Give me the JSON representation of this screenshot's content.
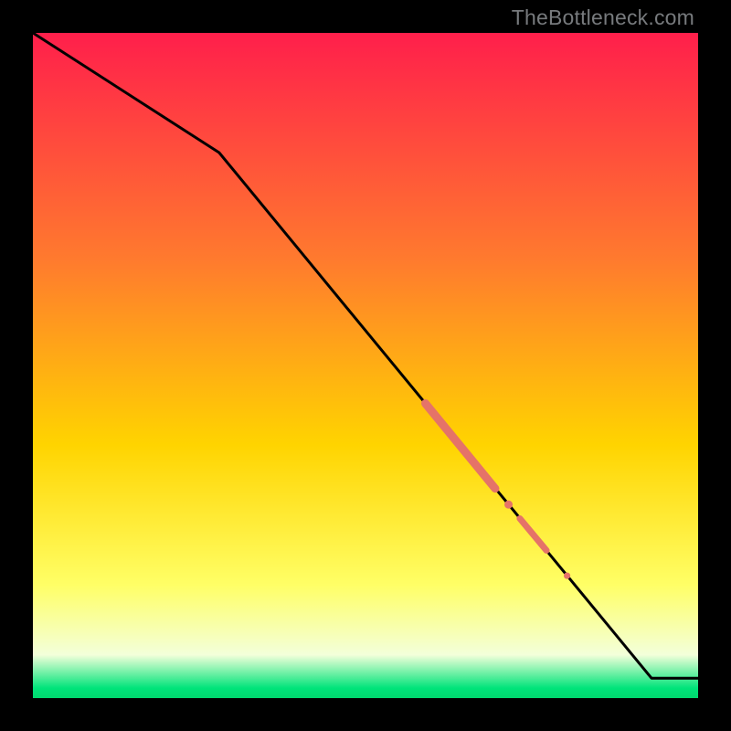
{
  "watermark": "TheBottleneck.com",
  "colors": {
    "frame": "#000000",
    "line": "#000000",
    "marker": "#e57368",
    "grad_top": "#ff1f4b",
    "grad_mid1": "#ff7a2e",
    "grad_mid2": "#ffd400",
    "grad_mid3": "#ffff66",
    "grad_pale": "#f3ffda",
    "grad_green": "#00e47a"
  },
  "chart_data": {
    "type": "line",
    "title": "",
    "xlabel": "",
    "ylabel": "",
    "xlim": [
      0,
      100
    ],
    "ylim": [
      0,
      100
    ],
    "series": [
      {
        "name": "curve",
        "x": [
          0,
          28,
          93,
          100
        ],
        "y": [
          100,
          82,
          3,
          3
        ]
      }
    ],
    "markers": [
      {
        "name": "segment-a",
        "kind": "segment",
        "x0": 59,
        "y0": 44.3,
        "x1": 69.5,
        "y1": 31.5,
        "weight": 9
      },
      {
        "name": "dot-mid",
        "kind": "dot",
        "x": 71.5,
        "y": 29.1,
        "r": 4.5
      },
      {
        "name": "segment-b",
        "kind": "segment",
        "x0": 73.2,
        "y0": 27.0,
        "x1": 77.2,
        "y1": 22.2,
        "weight": 7
      },
      {
        "name": "dot-low",
        "kind": "dot",
        "x": 80.3,
        "y": 18.4,
        "r": 3.6
      }
    ]
  }
}
